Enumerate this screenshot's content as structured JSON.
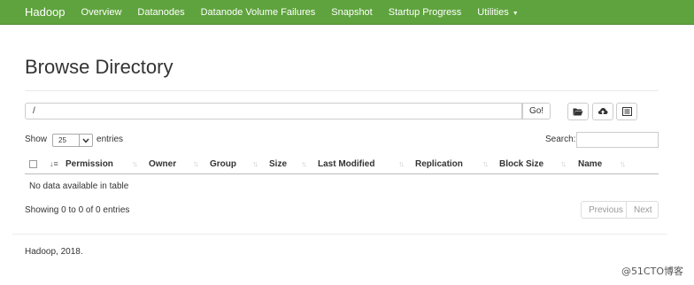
{
  "navbar": {
    "brand": "Hadoop",
    "items": [
      {
        "label": "Overview"
      },
      {
        "label": "Datanodes"
      },
      {
        "label": "Datanode Volume Failures"
      },
      {
        "label": "Snapshot"
      },
      {
        "label": "Startup Progress"
      },
      {
        "label": "Utilities"
      }
    ]
  },
  "page": {
    "title": "Browse Directory"
  },
  "path_bar": {
    "value": "/",
    "go_label": "Go!",
    "icons": [
      "folder-open-icon",
      "upload-cloud-icon",
      "list-alt-icon"
    ]
  },
  "controls": {
    "show_label": "Show",
    "entries_value": "25",
    "entries_label": "entries",
    "search_label": "Search:",
    "search_value": ""
  },
  "table": {
    "columns": [
      "Permission",
      "Owner",
      "Group",
      "Size",
      "Last Modified",
      "Replication",
      "Block Size",
      "Name"
    ],
    "empty_message": "No data available in table",
    "info": "Showing 0 to 0 of 0 entries",
    "pagination": {
      "previous": "Previous",
      "next": "Next"
    }
  },
  "footer": {
    "text": "Hadoop, 2018."
  },
  "watermark": {
    "text": "@51CTO博客"
  },
  "colors": {
    "navbar_bg": "#5fa33e",
    "navbar_text": "#ffffff"
  }
}
